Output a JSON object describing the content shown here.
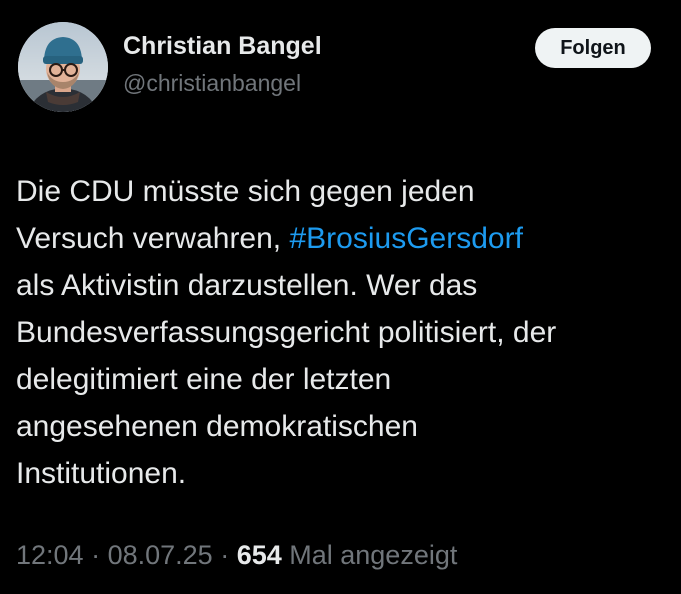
{
  "author": {
    "display_name": "Christian Bangel",
    "handle": "@christianbangel"
  },
  "follow_button": {
    "label": "Folgen"
  },
  "tweet": {
    "lines": [
      [
        "Die CDU müsste sich gegen jeden"
      ],
      [
        "Versuch verwahren, ",
        "#BrosiusGersdorf"
      ],
      [
        "als Aktivistin darzustellen. Wer das"
      ],
      [
        "Bundesverfassungsgericht politisiert, der"
      ],
      [
        "delegitimiert eine der letzten"
      ],
      [
        "angesehenen demokratischen"
      ],
      [
        "Institutionen."
      ]
    ]
  },
  "meta": {
    "time": "12:04",
    "separator": " · ",
    "date": "08.07.25",
    "views_count": "654",
    "views_label": " Mal angezeigt"
  },
  "colors": {
    "background": "#000000",
    "text": "#e7e9ea",
    "muted": "#71767b",
    "link": "#1d9bf0",
    "button_bg": "#eff3f4"
  },
  "icons": {
    "avatar": "profile-photo"
  }
}
